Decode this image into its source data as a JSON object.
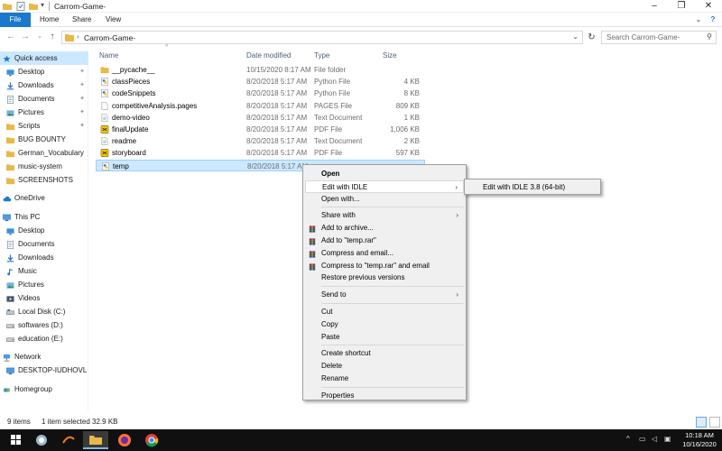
{
  "window": {
    "title": "Carrom-Game-"
  },
  "ribbon": {
    "tabs": [
      "File",
      "Home",
      "Share",
      "View"
    ]
  },
  "address": {
    "path": "Carrom-Game-",
    "search_placeholder": "Search Carrom-Game-"
  },
  "nav": {
    "items": [
      {
        "label": "Quick access",
        "icon": "star-icon",
        "pinned": false
      },
      {
        "label": "Desktop",
        "icon": "desktop-icon",
        "pinned": true
      },
      {
        "label": "Downloads",
        "icon": "download-icon",
        "pinned": true
      },
      {
        "label": "Documents",
        "icon": "documents-icon",
        "pinned": true
      },
      {
        "label": "Pictures",
        "icon": "pictures-icon",
        "pinned": true
      },
      {
        "label": "Scripts",
        "icon": "folder-icon",
        "pinned": true
      },
      {
        "label": "BUG BOUNTY",
        "icon": "folder-icon",
        "pinned": false
      },
      {
        "label": "German_Vocabulary",
        "icon": "folder-icon",
        "pinned": false
      },
      {
        "label": "music-system",
        "icon": "folder-icon",
        "pinned": false
      },
      {
        "label": "SCREENSHOTS",
        "icon": "folder-icon",
        "pinned": false
      },
      {
        "label": "OneDrive",
        "icon": "cloud-icon",
        "pinned": false
      },
      {
        "label": "This PC",
        "icon": "computer-icon",
        "pinned": false
      },
      {
        "label": "Desktop",
        "icon": "desktop-icon",
        "pinned": false
      },
      {
        "label": "Documents",
        "icon": "documents-icon",
        "pinned": false
      },
      {
        "label": "Downloads",
        "icon": "download-icon",
        "pinned": false
      },
      {
        "label": "Music",
        "icon": "music-icon",
        "pinned": false
      },
      {
        "label": "Pictures",
        "icon": "pictures-icon",
        "pinned": false
      },
      {
        "label": "Videos",
        "icon": "videos-icon",
        "pinned": false
      },
      {
        "label": "Local Disk (C:)",
        "icon": "disk-icon",
        "pinned": false
      },
      {
        "label": "softwares (D:)",
        "icon": "drive-icon",
        "pinned": false
      },
      {
        "label": "education (E:)",
        "icon": "drive-icon",
        "pinned": false
      },
      {
        "label": "Network",
        "icon": "network-icon",
        "pinned": false
      },
      {
        "label": "DESKTOP-IUDHOVL",
        "icon": "computer-icon",
        "pinned": false
      },
      {
        "label": "Homegroup",
        "icon": "homegroup-icon",
        "pinned": false
      }
    ]
  },
  "columns": {
    "name": "Name",
    "date": "Date modified",
    "type": "Type",
    "size": "Size"
  },
  "files": [
    {
      "name": "__pycache__",
      "date": "10/15/2020 8:17 AM",
      "type": "File folder",
      "size": "",
      "icon": "folder-icon"
    },
    {
      "name": "classPieces",
      "date": "8/20/2018 5:17 AM",
      "type": "Python File",
      "size": "4 KB",
      "icon": "python-file-icon"
    },
    {
      "name": "codeSnippets",
      "date": "8/20/2018 5:17 AM",
      "type": "Python File",
      "size": "8 KB",
      "icon": "python-file-icon"
    },
    {
      "name": "competitiveAnalysis.pages",
      "date": "8/20/2018 5:17 AM",
      "type": "PAGES File",
      "size": "809 KB",
      "icon": "file-icon"
    },
    {
      "name": "demo-video",
      "date": "8/20/2018 5:17 AM",
      "type": "Text Document",
      "size": "1 KB",
      "icon": "text-file-icon"
    },
    {
      "name": "finalUpdate",
      "date": "8/20/2018 5:17 AM",
      "type": "PDF File",
      "size": "1,006 KB",
      "icon": "pdf-file-icon"
    },
    {
      "name": "readme",
      "date": "8/20/2018 5:17 AM",
      "type": "Text Document",
      "size": "2 KB",
      "icon": "text-file-icon"
    },
    {
      "name": "storyboard",
      "date": "8/20/2018 5:17 AM",
      "type": "PDF File",
      "size": "597 KB",
      "icon": "pdf-file-icon"
    },
    {
      "name": "temp",
      "date": "8/20/2018 5:17 AM",
      "type": "",
      "size": "",
      "icon": "python-file-icon",
      "selected": true
    }
  ],
  "context_menu": {
    "items": [
      {
        "label": "Open",
        "bold": true
      },
      {
        "label": "Edit with IDLE",
        "submenu": true,
        "highlighted": true
      },
      {
        "label": "Open with..."
      },
      {
        "sep": true
      },
      {
        "label": "Share with",
        "submenu": true
      },
      {
        "label": "Add to archive...",
        "icon": "winrar-icon"
      },
      {
        "label": "Add to \"temp.rar\"",
        "icon": "winrar-icon"
      },
      {
        "label": "Compress and email...",
        "icon": "winrar-icon"
      },
      {
        "label": "Compress to \"temp.rar\" and email",
        "icon": "winrar-icon"
      },
      {
        "label": "Restore previous versions"
      },
      {
        "sep": true
      },
      {
        "label": "Send to",
        "submenu": true
      },
      {
        "sep": true
      },
      {
        "label": "Cut"
      },
      {
        "label": "Copy"
      },
      {
        "label": "Paste"
      },
      {
        "sep": true
      },
      {
        "label": "Create shortcut"
      },
      {
        "label": "Delete"
      },
      {
        "label": "Rename"
      },
      {
        "sep": true
      },
      {
        "label": "Properties"
      }
    ]
  },
  "submenu": {
    "items": [
      {
        "label": "Edit with IDLE 3.8 (64-bit)"
      }
    ]
  },
  "status": {
    "items": "9 items",
    "selection": "1 item selected  32.9 KB"
  },
  "taskbar": {
    "time": "10:18 AM",
    "date": "10/16/2020"
  },
  "colors": {
    "accent": "#1979ca",
    "selection": "#cce8ff",
    "folder": "#e8b84a",
    "taskbar": "#101010"
  }
}
